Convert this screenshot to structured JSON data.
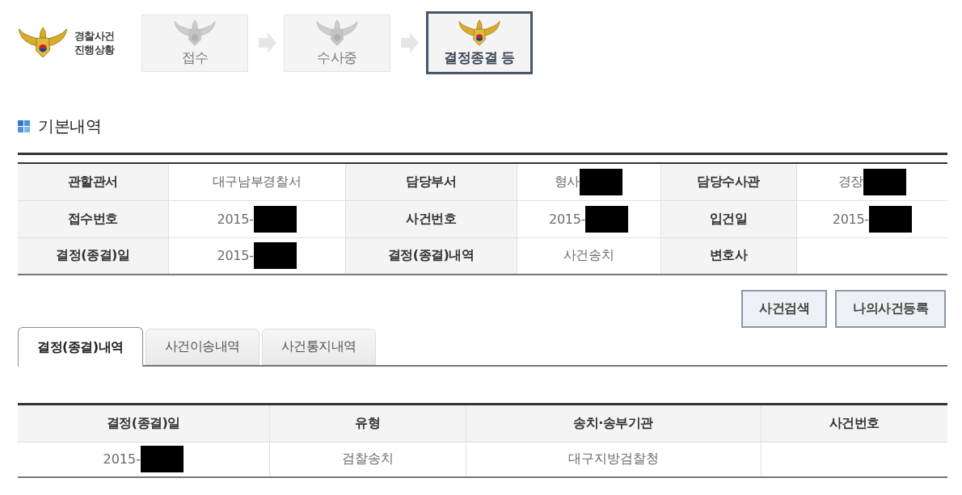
{
  "header": {
    "title_lines": [
      "경찰사건",
      "진행상황"
    ]
  },
  "steps": [
    {
      "label": "접수",
      "current": false
    },
    {
      "label": "수사중",
      "current": false
    },
    {
      "label": "결정종결 등",
      "current": true
    }
  ],
  "section": {
    "title": "기본내역"
  },
  "details": {
    "rows": [
      [
        {
          "label": "관할관서",
          "value": "대구남부경찰서",
          "redacted": false
        },
        {
          "label": "담당부서",
          "value": "형사",
          "redacted": true
        },
        {
          "label": "담당수사관",
          "value": "경장",
          "redacted": true
        }
      ],
      [
        {
          "label": "접수번호",
          "value": "2015-",
          "redacted": true
        },
        {
          "label": "사건번호",
          "value": "2015-",
          "redacted": true
        },
        {
          "label": "입건일",
          "value": "2015-",
          "redacted": true
        }
      ],
      [
        {
          "label": "결정(종결)일",
          "value": "2015-",
          "redacted": true
        },
        {
          "label": "결정(종결)내역",
          "value": "사건송치",
          "redacted": false
        },
        {
          "label": "변호사",
          "redacted": false
        }
      ]
    ]
  },
  "actions": [
    {
      "label": "사건검색"
    },
    {
      "label": "나의사건등록"
    }
  ],
  "tabs": [
    {
      "label": "결정(종결)내역",
      "selected": true
    },
    {
      "label": "사건이송내역",
      "selected": false
    },
    {
      "label": "사건통지내역",
      "selected": false
    }
  ],
  "results": {
    "columns": [
      "결정(종결)일",
      "유형",
      "송치·송부기관",
      "사건번호"
    ],
    "rows": [
      [
        {
          "text": "2015-",
          "redacted": true
        },
        {
          "text": "검찰송치",
          "redacted": false
        },
        {
          "text": "대구지방검찰청",
          "redacted": false
        },
        {
          "redacted": false
        }
      ]
    ]
  }
}
